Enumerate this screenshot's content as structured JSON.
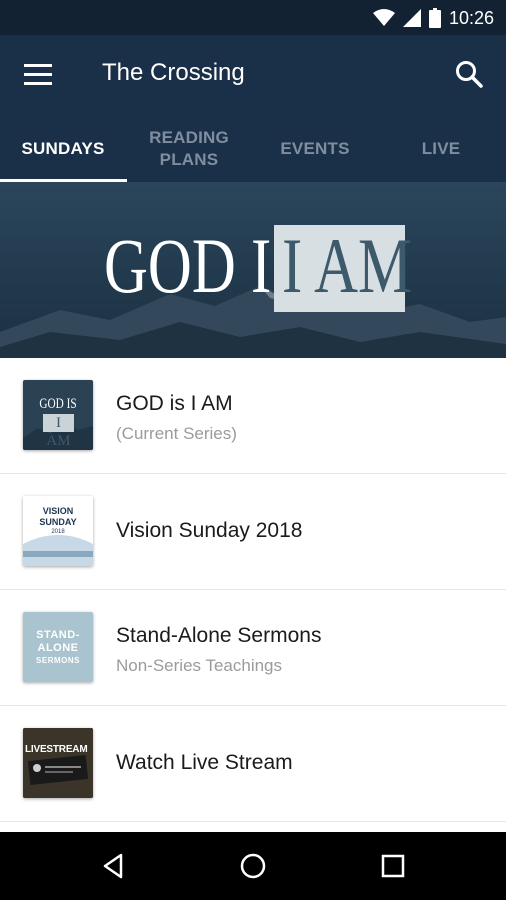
{
  "status_bar": {
    "time": "10:26",
    "icons": [
      "wifi-icon",
      "signal-icon",
      "battery-icon"
    ]
  },
  "app_bar": {
    "title": "The Crossing",
    "menu_icon": "hamburger-menu-icon",
    "search_icon": "search-icon"
  },
  "tabs": [
    {
      "label": "SUNDAYS",
      "active": true
    },
    {
      "label": "READING\nPLANS",
      "active": false
    },
    {
      "label": "EVENTS",
      "active": false
    },
    {
      "label": "LIVE",
      "active": false
    }
  ],
  "banner": {
    "text_left": "GOD IS",
    "text_right": "I AM"
  },
  "list": [
    {
      "title": "GOD is I AM",
      "subtitle": "(Current Series)",
      "thumb_lines": [
        "GOD IS",
        "I AM"
      ]
    },
    {
      "title": "Vision Sunday 2018",
      "subtitle": "",
      "thumb_lines": [
        "VISION",
        "SUNDAY",
        "2018"
      ]
    },
    {
      "title": "Stand-Alone Sermons",
      "subtitle": "Non-Series Teachings",
      "thumb_lines": [
        "STAND-",
        "ALONE",
        "SERMONS"
      ]
    },
    {
      "title": "Watch Live Stream",
      "subtitle": "",
      "thumb_lines": [
        "LIVESTREAM"
      ]
    }
  ],
  "nav_bar": {
    "icons": [
      "back-icon",
      "home-icon",
      "recents-icon"
    ]
  },
  "colors": {
    "app_bar": "#1a3049",
    "status_bar": "#122233",
    "inactive_tab": "#7f8e9e",
    "subtitle": "#9b9b9b"
  }
}
